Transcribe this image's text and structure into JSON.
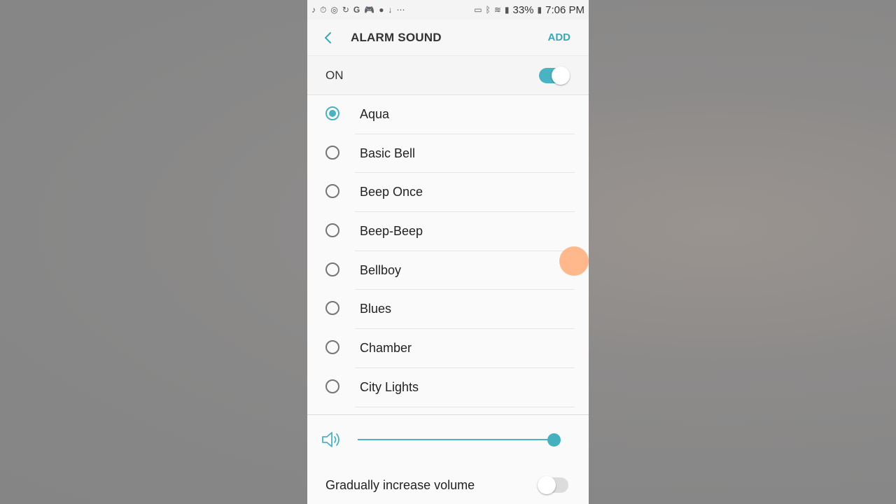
{
  "statusbar": {
    "battery": "33%",
    "time": "7:06 PM",
    "icons": [
      "tiktok-icon",
      "timer-icon",
      "sync-icon",
      "refresh-icon",
      "google-icon",
      "gamepad-icon",
      "video-icon",
      "download-icon",
      "more-icon",
      "cast-icon",
      "bluetooth-icon",
      "wifi-icon",
      "signal-icon",
      "battery-icon"
    ]
  },
  "appbar": {
    "title": "ALARM SOUND",
    "add_label": "ADD"
  },
  "master_toggle": {
    "label": "ON",
    "state": "on"
  },
  "sounds": [
    {
      "label": "Aqua",
      "selected": true
    },
    {
      "label": "Basic Bell",
      "selected": false
    },
    {
      "label": "Beep Once",
      "selected": false
    },
    {
      "label": "Beep-Beep",
      "selected": false
    },
    {
      "label": "Bellboy",
      "selected": false
    },
    {
      "label": "Blues",
      "selected": false
    },
    {
      "label": "Chamber",
      "selected": false
    },
    {
      "label": "City Lights",
      "selected": false
    }
  ],
  "volume": {
    "level": 1.0
  },
  "gradual": {
    "label": "Gradually increase volume",
    "state": "off"
  },
  "colors": {
    "accent": "#49b3c1",
    "background": "#fafafa",
    "outer": "#878787"
  }
}
